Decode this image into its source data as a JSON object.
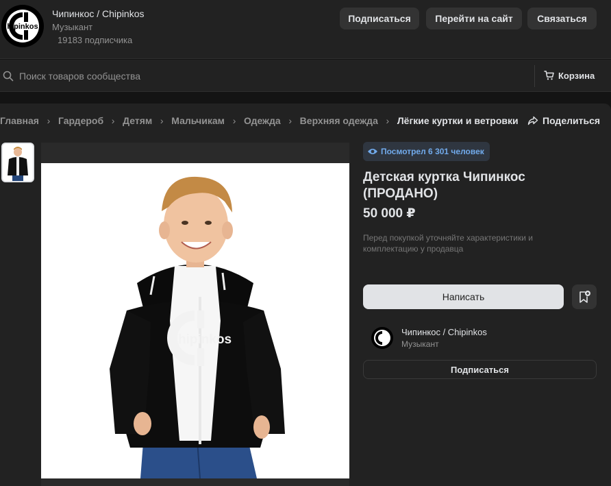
{
  "header": {
    "community_name": "Чипинкос / Chipinkos",
    "category": "Музыкант",
    "subscribers": "19183 подписчика",
    "logo_text": "hipinkos",
    "buttons": {
      "subscribe": "Подписаться",
      "go_to_site": "Перейти на сайт",
      "contact": "Связаться"
    }
  },
  "search": {
    "placeholder": "Поиск товаров сообщества",
    "cart_label": "Корзина"
  },
  "breadcrumbs": [
    "Главная",
    "Гардероб",
    "Детям",
    "Мальчикам",
    "Одежда",
    "Верхняя одежда",
    "Лёгкие куртки и ветровки"
  ],
  "share_label": "Поделиться",
  "product": {
    "views": "Посмотрел 6 301 человек",
    "title": "Детская куртка Чипинкос (ПРОДАНО)",
    "price": "50 000 ₽",
    "note": "Перед покупкой уточняйте характеристики и комплектацию у продавца",
    "write_button": "Написать",
    "jacket_print": "hipinkos"
  },
  "seller": {
    "name": "Чипинкос / Chipinkos",
    "role": "Музыкант",
    "subscribe_button": "Подписаться"
  },
  "colors": {
    "background": "#141414",
    "panel": "#222222",
    "accent": "#71aaeb"
  }
}
